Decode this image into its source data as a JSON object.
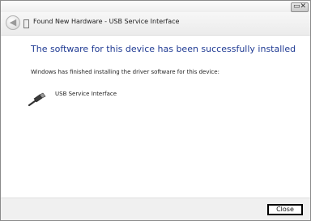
{
  "window": {
    "controls_glyph": "▭✕"
  },
  "nav": {
    "back_glyph": "◀",
    "title": "Found New Hardware - USB Service Interface"
  },
  "content": {
    "heading": "The software for this device has been successfully installed",
    "description": "Windows has finished installing the driver software for this device:",
    "device": {
      "name": "USB Service Interface",
      "icon": "usb-plug-icon"
    }
  },
  "footer": {
    "close_label": "Close"
  },
  "colors": {
    "heading": "#1f3a93",
    "footer_bg": "#f0f0f0"
  }
}
